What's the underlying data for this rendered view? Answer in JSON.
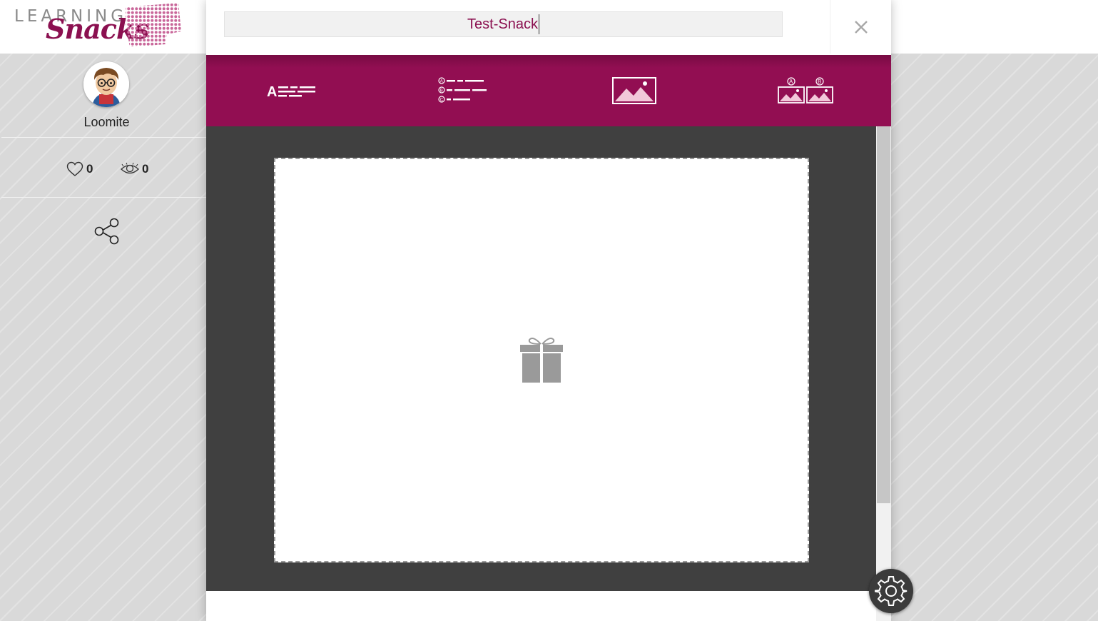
{
  "brand": {
    "logo_word_top": "LEARNING",
    "logo_word_bottom": "Snacks"
  },
  "user": {
    "name": "Loomite",
    "likes": "0",
    "views": "0"
  },
  "editor": {
    "title_value": "Test-Snack",
    "toolbar": [
      {
        "icon": "text-question-icon"
      },
      {
        "icon": "multiple-choice-icon"
      },
      {
        "icon": "image-icon"
      },
      {
        "icon": "image-choice-icon"
      }
    ],
    "placeholder_icon": "gift-icon"
  },
  "colors": {
    "accent": "#920e52",
    "accent_dark": "#770b43",
    "stage": "#404040"
  }
}
